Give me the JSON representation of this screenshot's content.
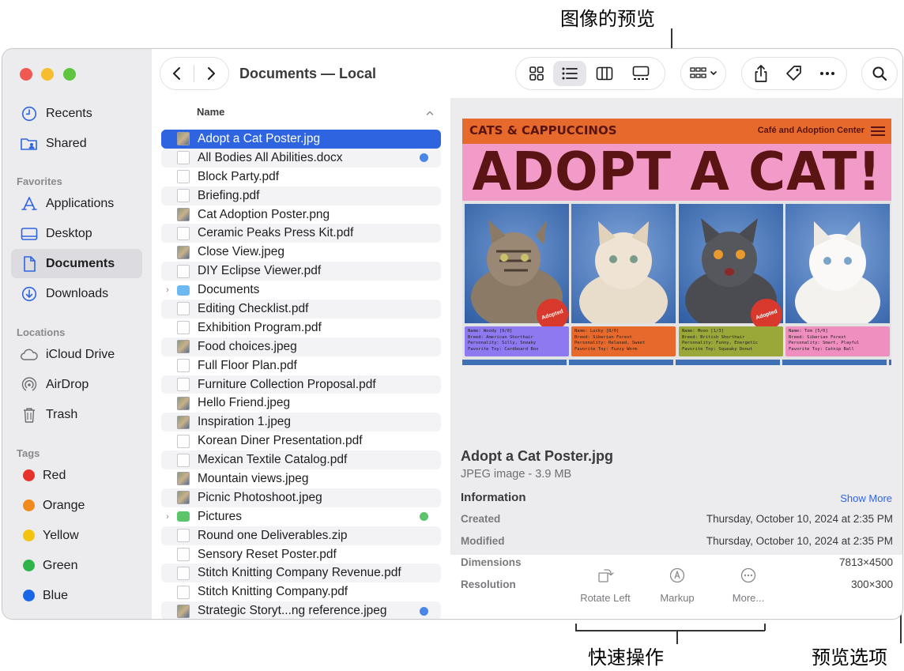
{
  "callouts": {
    "preview": "图像的预览",
    "quick_actions": "快速操作",
    "preview_options": "预览选项"
  },
  "window": {
    "title": "Documents — Local",
    "colors": {
      "accent": "#2f64e0",
      "sidebar_bg": "#ececee"
    }
  },
  "sidebar": {
    "top": [
      {
        "label": "Recents",
        "icon": "clock-icon"
      },
      {
        "label": "Shared",
        "icon": "shared-folder-icon"
      }
    ],
    "favorites_header": "Favorites",
    "favorites": [
      {
        "label": "Applications",
        "icon": "applications-icon"
      },
      {
        "label": "Desktop",
        "icon": "desktop-icon"
      },
      {
        "label": "Documents",
        "icon": "document-icon",
        "selected": true
      },
      {
        "label": "Downloads",
        "icon": "download-icon"
      }
    ],
    "locations_header": "Locations",
    "locations": [
      {
        "label": "iCloud Drive",
        "icon": "cloud-icon"
      },
      {
        "label": "AirDrop",
        "icon": "airdrop-icon"
      },
      {
        "label": "Trash",
        "icon": "trash-icon"
      }
    ],
    "tags_header": "Tags",
    "tags": [
      {
        "label": "Red",
        "color": "#e8312a"
      },
      {
        "label": "Orange",
        "color": "#f08a1c"
      },
      {
        "label": "Yellow",
        "color": "#f2c40f"
      },
      {
        "label": "Green",
        "color": "#2fb44a"
      },
      {
        "label": "Blue",
        "color": "#1a66e8"
      }
    ]
  },
  "filelist": {
    "column_name": "Name",
    "files": [
      {
        "name": "Adopt a Cat Poster.jpg",
        "icon": "image",
        "selected": true
      },
      {
        "name": "All Bodies All Abilities.docx",
        "icon": "doc",
        "tag": "#4a86e8"
      },
      {
        "name": "Block Party.pdf",
        "icon": "doc"
      },
      {
        "name": "Briefing.pdf",
        "icon": "doc"
      },
      {
        "name": "Cat Adoption Poster.png",
        "icon": "image"
      },
      {
        "name": "Ceramic Peaks Press Kit.pdf",
        "icon": "doc"
      },
      {
        "name": "Close View.jpeg",
        "icon": "image"
      },
      {
        "name": "DIY Eclipse Viewer.pdf",
        "icon": "doc"
      },
      {
        "name": "Documents",
        "icon": "folder",
        "disclosure": true
      },
      {
        "name": "Editing Checklist.pdf",
        "icon": "doc"
      },
      {
        "name": "Exhibition Program.pdf",
        "icon": "doc"
      },
      {
        "name": "Food choices.jpeg",
        "icon": "image"
      },
      {
        "name": "Full Floor Plan.pdf",
        "icon": "doc"
      },
      {
        "name": "Furniture Collection Proposal.pdf",
        "icon": "doc"
      },
      {
        "name": "Hello Friend.jpeg",
        "icon": "image"
      },
      {
        "name": "Inspiration 1.jpeg",
        "icon": "image"
      },
      {
        "name": "Korean Diner Presentation.pdf",
        "icon": "doc"
      },
      {
        "name": "Mexican Textile Catalog.pdf",
        "icon": "doc"
      },
      {
        "name": "Mountain views.jpeg",
        "icon": "image"
      },
      {
        "name": "Picnic Photoshoot.jpeg",
        "icon": "image"
      },
      {
        "name": "Pictures",
        "icon": "folder-green",
        "disclosure": true,
        "tag": "#5cc46a"
      },
      {
        "name": "Round one Deliverables.zip",
        "icon": "doc"
      },
      {
        "name": "Sensory Reset Poster.pdf",
        "icon": "doc"
      },
      {
        "name": "Stitch Knitting Company Revenue.pdf",
        "icon": "doc"
      },
      {
        "name": "Stitch Knitting Company.pdf",
        "icon": "doc"
      },
      {
        "name": "Strategic Storyt...ng reference.jpeg",
        "icon": "image",
        "tag": "#4a86e8"
      }
    ]
  },
  "poster": {
    "brand": "CATS & CAPPUCCINOS",
    "subtitle": "Café and Adoption Center",
    "headline": "ADOPT A CAT!",
    "stamp": "Adopted",
    "cards": [
      {
        "color": "#8f79f0",
        "lines": [
          "Name: Woody [9/0]",
          "Breed: American Shorthair",
          "Personality: Silly, Sneaky",
          "Favorite Toy: Cardboard Box"
        ]
      },
      {
        "color": "#e8692c",
        "lines": [
          "Name: Lucky [8/0]",
          "Breed: Siberian Forest",
          "Personality: Relaxed, Sweet",
          "Favorite Toy: Fuzzy Worm"
        ]
      },
      {
        "color": "#9aa83a",
        "lines": [
          "Name: Moon [1/3]",
          "Breed: British Shorthair",
          "Personality: Funny, Energetic",
          "Favorite Toy: Squeaky Donut"
        ]
      },
      {
        "color": "#ef8fc0",
        "lines": [
          "Name: Tom [5/0]",
          "Breed: Siberian Forest",
          "Personality: Smart, Playful",
          "Favorite Toy: Catnip Ball"
        ]
      }
    ]
  },
  "preview": {
    "filename": "Adopt a Cat Poster.jpg",
    "kind": "JPEG image - 3.9 MB",
    "info_header": "Information",
    "show_more": "Show More",
    "info": [
      {
        "key": "Created",
        "value": "Thursday, October 10, 2024 at 2:35 PM"
      },
      {
        "key": "Modified",
        "value": "Thursday, October 10, 2024 at 2:35 PM"
      },
      {
        "key": "Dimensions",
        "value": "7813×4500"
      },
      {
        "key": "Resolution",
        "value": "300×300"
      }
    ]
  },
  "quick_actions": [
    {
      "label": "Rotate Left",
      "icon": "rotate-left-icon"
    },
    {
      "label": "Markup",
      "icon": "markup-icon"
    },
    {
      "label": "More...",
      "icon": "more-circle-icon"
    }
  ]
}
